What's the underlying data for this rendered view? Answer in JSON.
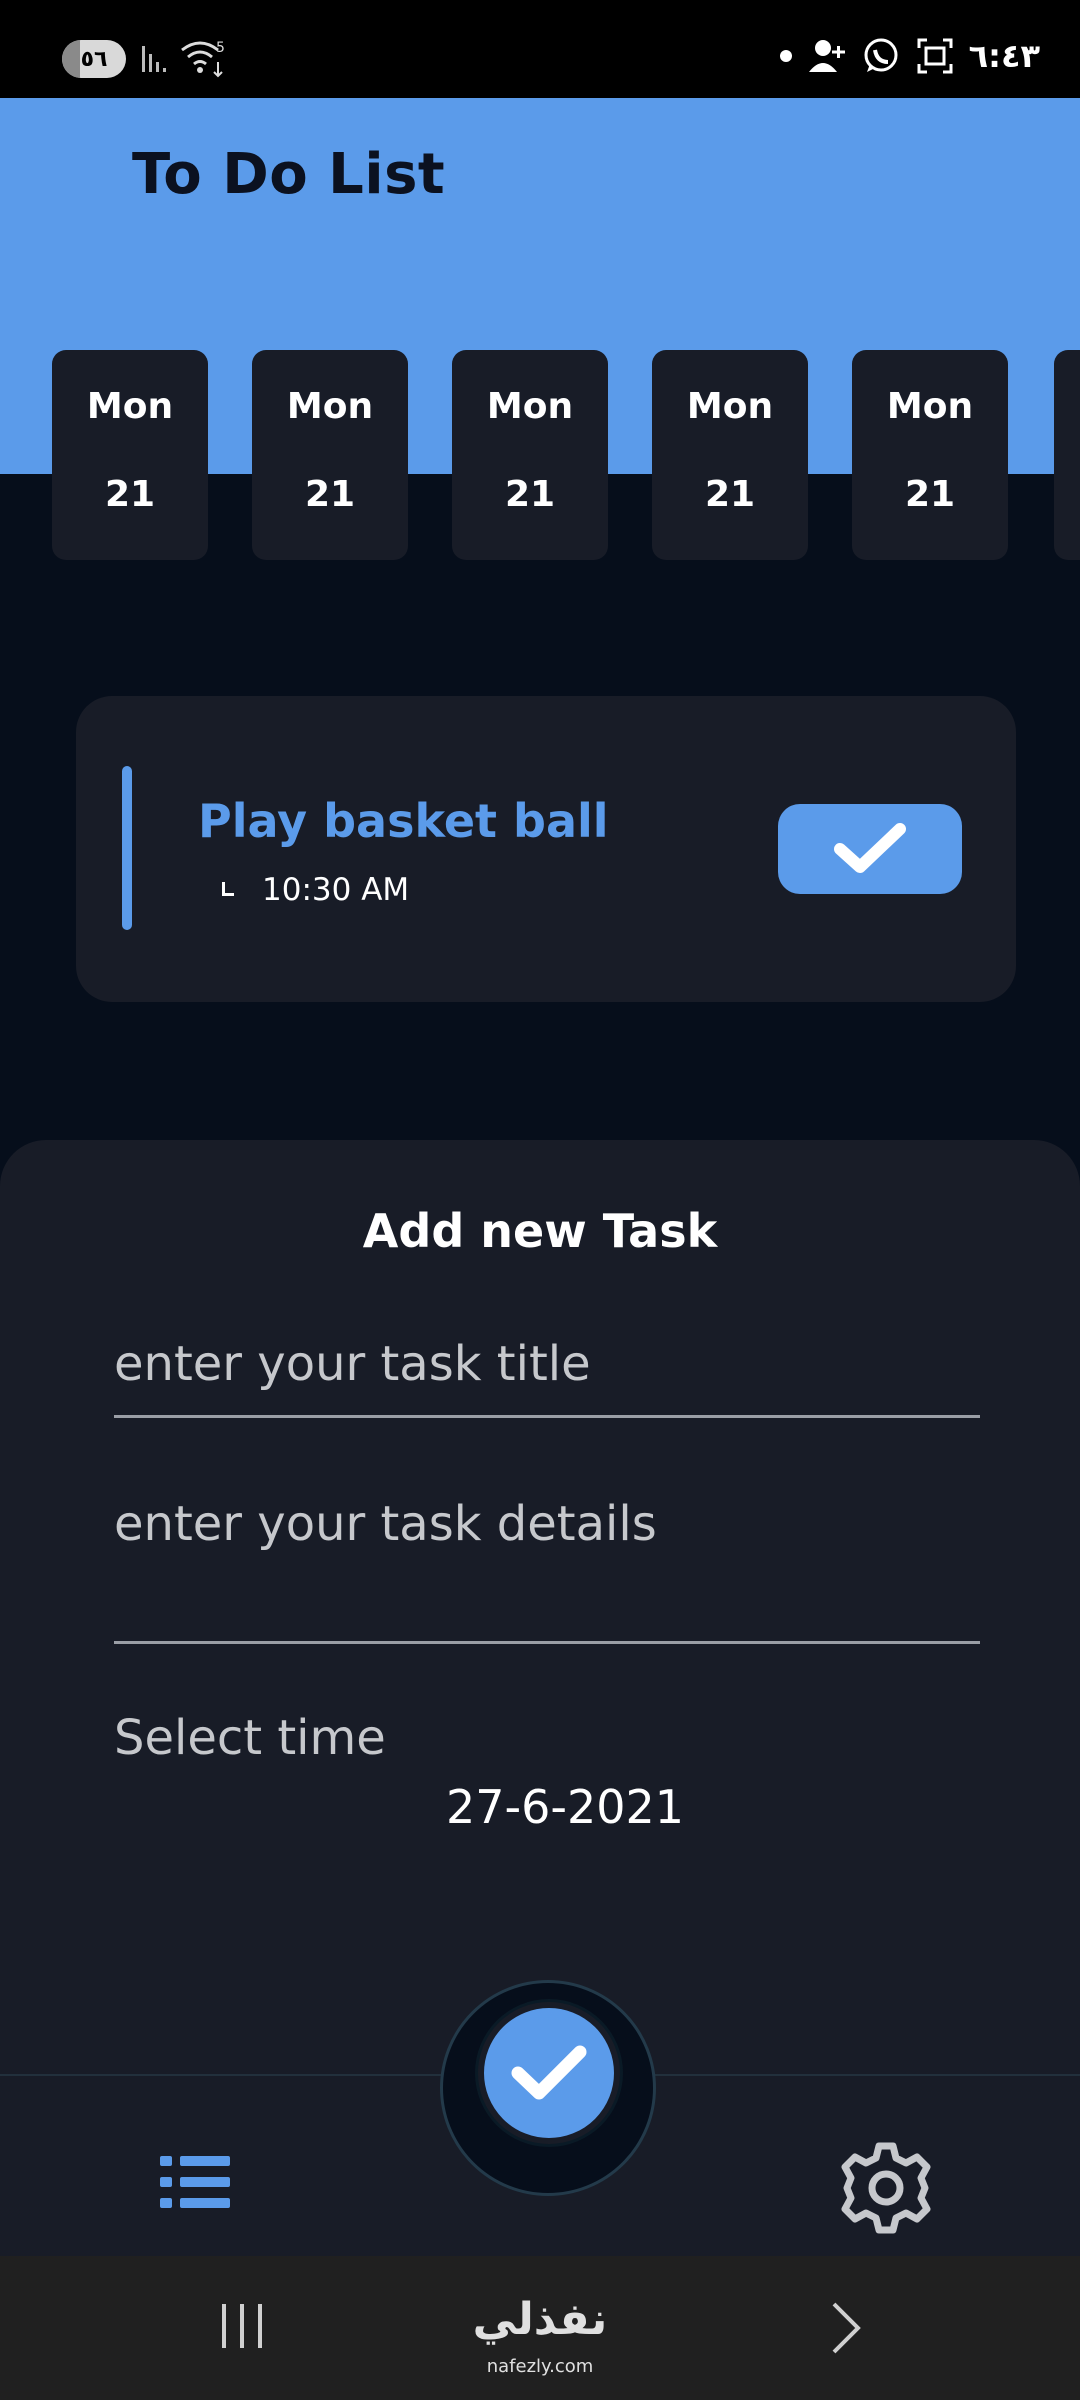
{
  "status_bar": {
    "battery": "٥٦",
    "time": "٦:٤٣",
    "wifi_badge": "5"
  },
  "header": {
    "title": "To Do List"
  },
  "dates": [
    {
      "day": "Mon",
      "num": "21"
    },
    {
      "day": "Mon",
      "num": "21"
    },
    {
      "day": "Mon",
      "num": "21"
    },
    {
      "day": "Mon",
      "num": "21"
    },
    {
      "day": "Mon",
      "num": "21"
    }
  ],
  "task": {
    "title": "Play basket ball",
    "time": "10:30 AM"
  },
  "add_task": {
    "heading": "Add new Task",
    "title_placeholder": "enter your task title",
    "details_placeholder": "enter your task details",
    "select_time_label": "Select time",
    "selected_date": "27-6-2021"
  },
  "watermark": {
    "arabic": "نفذلي",
    "latin": "nafezly.com"
  },
  "colors": {
    "accent": "#5b9bea",
    "background": "#060e1b",
    "card": "#181c27"
  },
  "icons": {
    "task_check": "check-icon",
    "fab": "check-icon",
    "nav_left": "list-icon",
    "nav_right": "gear-icon"
  }
}
